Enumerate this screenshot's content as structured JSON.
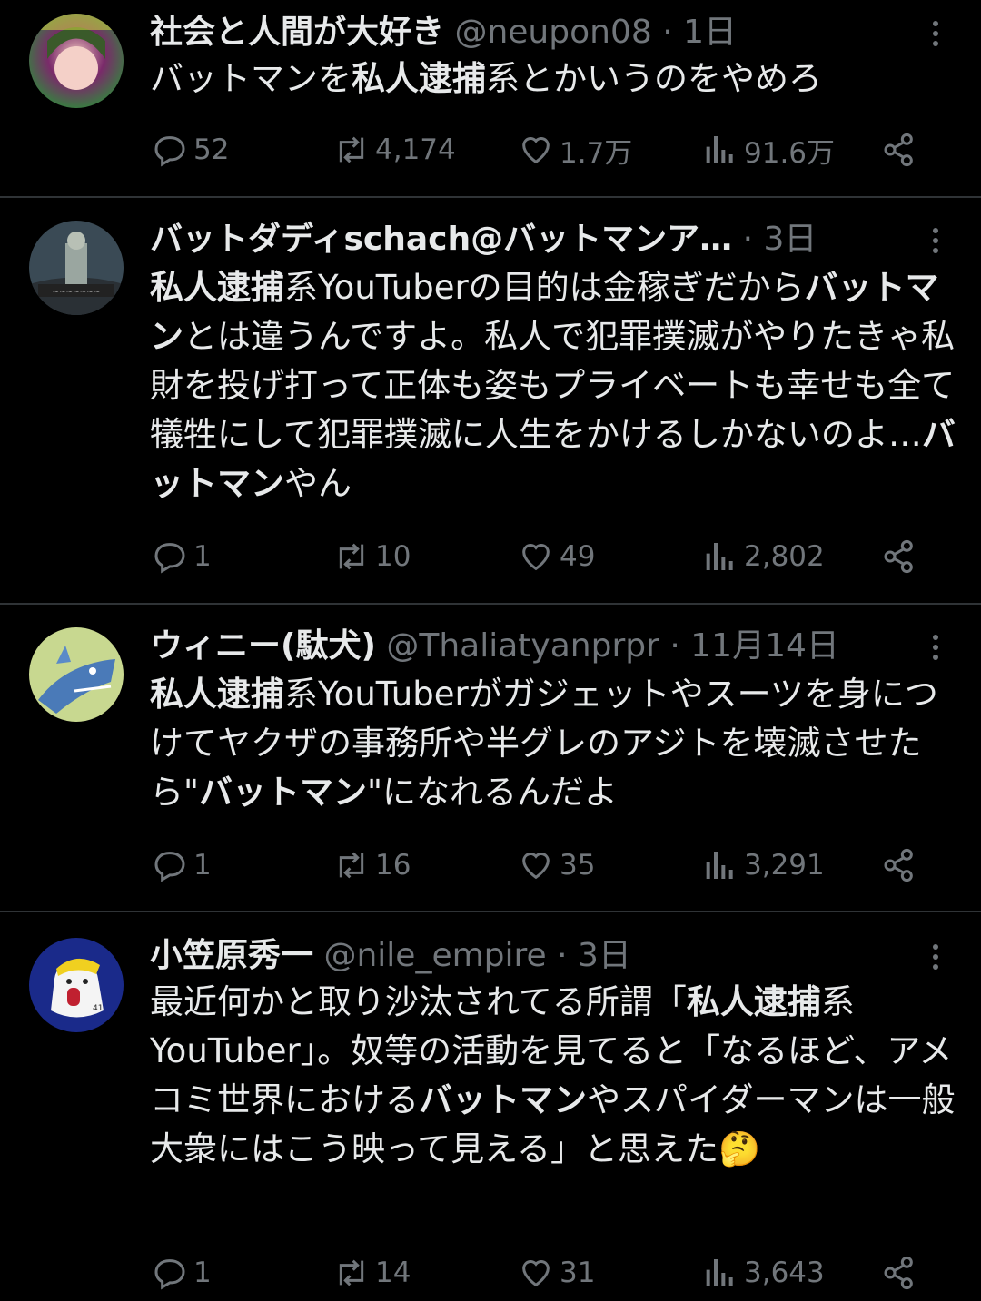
{
  "tweets": [
    {
      "name": "社会と人間が大好き",
      "handle": "@neupon08",
      "time": "1日",
      "body": [
        {
          "t": "バットマンを"
        },
        {
          "t": "私人逮捕",
          "b": true
        },
        {
          "t": "系とかいうのをやめろ"
        }
      ],
      "replies": "52",
      "retweets": "4,174",
      "likes": "1.7万",
      "views": "91.6万"
    },
    {
      "name": "バットダディschach@バットマンア…",
      "handle": "",
      "time": "3日",
      "body": [
        {
          "t": "私人逮捕",
          "b": true
        },
        {
          "t": "系YouTuberの目的は金稼ぎだから"
        },
        {
          "t": "バットマン",
          "b": true
        },
        {
          "t": "とは違うんですよ。私人で犯罪撲滅がやりたきゃ私財を投げ打って正体も姿もプライベートも幸せも全て犠牲にして犯罪撲滅に人生をかけるしかないのよ…"
        },
        {
          "t": "バットマン",
          "b": true
        },
        {
          "t": "やん"
        }
      ],
      "replies": "1",
      "retweets": "10",
      "likes": "49",
      "views": "2,802"
    },
    {
      "name": "ウィニー(駄犬)",
      "handle": "@Thaliatyanprpr",
      "time": "11月14日",
      "body": [
        {
          "t": "私人逮捕",
          "b": true
        },
        {
          "t": "系YouTuberがガジェットやスーツを身につけてヤクザの事務所や半グレのアジトを壊滅させたら\""
        },
        {
          "t": "バットマン",
          "b": true
        },
        {
          "t": "\"になれるんだよ"
        }
      ],
      "replies": "1",
      "retweets": "16",
      "likes": "35",
      "views": "3,291"
    },
    {
      "name": "小笠原秀一",
      "handle": "@nile_empire",
      "time": "3日",
      "body": [
        {
          "t": "最近何かと取り沙汰されてる所謂「"
        },
        {
          "t": "私人逮捕",
          "b": true
        },
        {
          "t": "系YouTuber」。奴等の活動を見てると「なるほど、アメコミ世界における"
        },
        {
          "t": "バットマン",
          "b": true
        },
        {
          "t": "やスパイダーマンは一般大衆にはこう映って見える」と思えた🤔"
        }
      ],
      "replies": "1",
      "retweets": "14",
      "likes": "31",
      "views": "3,643"
    }
  ],
  "colors": {
    "text": "#e7e9ea",
    "muted": "#71767b",
    "divider": "#2f3336",
    "bg": "#000000"
  }
}
